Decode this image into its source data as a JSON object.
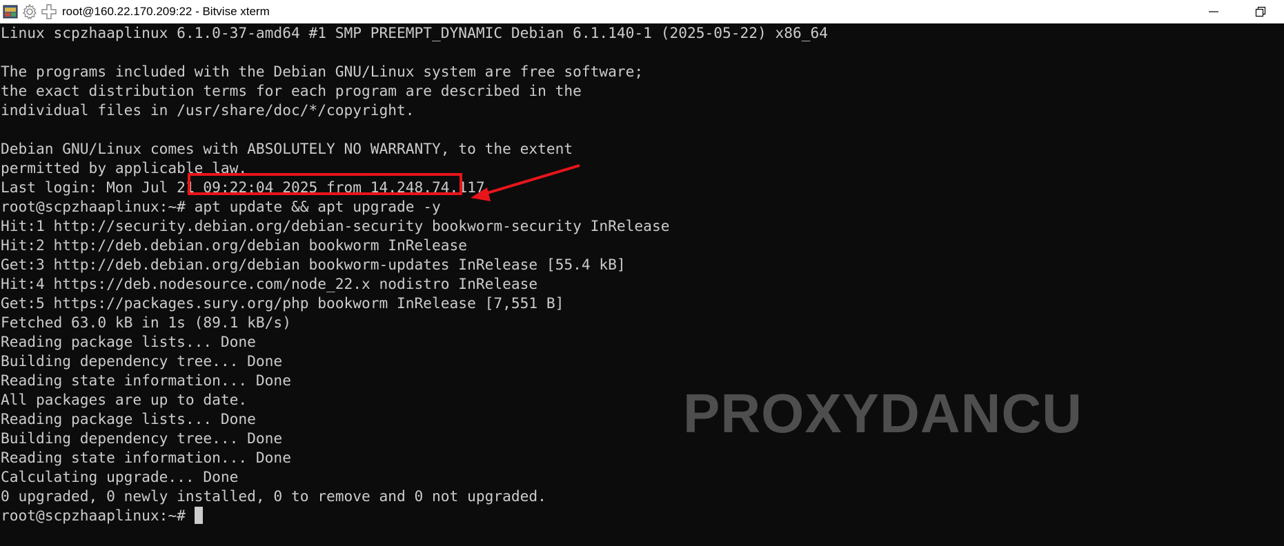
{
  "window": {
    "title": "root@160.22.170.209:22 - Bitvise xterm",
    "icons": [
      "app-icon",
      "gear-icon",
      "new-window-icon"
    ],
    "controls": [
      "minimize-icon",
      "restore-icon"
    ]
  },
  "terminal": {
    "lines": [
      "Linux scpzhaaplinux 6.1.0-37-amd64 #1 SMP PREEMPT_DYNAMIC Debian 6.1.140-1 (2025-05-22) x86_64",
      "",
      "The programs included with the Debian GNU/Linux system are free software;",
      "the exact distribution terms for each program are described in the",
      "individual files in /usr/share/doc/*/copyright.",
      "",
      "Debian GNU/Linux comes with ABSOLUTELY NO WARRANTY, to the extent",
      "permitted by applicable law.",
      "Last login: Mon Jul 21 09:22:04 2025 from 14.248.74.117",
      "root@scpzhaaplinux:~# apt update && apt upgrade -y",
      "Hit:1 http://security.debian.org/debian-security bookworm-security InRelease",
      "Hit:2 http://deb.debian.org/debian bookworm InRelease",
      "Get:3 http://deb.debian.org/debian bookworm-updates InRelease [55.4 kB]",
      "Hit:4 https://deb.nodesource.com/node_22.x nodistro InRelease",
      "Get:5 https://packages.sury.org/php bookworm InRelease [7,551 B]",
      "Fetched 63.0 kB in 1s (89.1 kB/s)",
      "Reading package lists... Done",
      "Building dependency tree... Done",
      "Reading state information... Done",
      "All packages are up to date.",
      "Reading package lists... Done",
      "Building dependency tree... Done",
      "Reading state information... Done",
      "Calculating upgrade... Done",
      "0 upgraded, 0 newly installed, 0 to remove and 0 not upgraded.",
      "root@scpzhaaplinux:~# "
    ],
    "highlighted_command": "apt update && apt upgrade -y",
    "annotation_color": "#e8151b",
    "text_color": "#cccccc",
    "background_color": "#0c0c0c"
  },
  "watermark": {
    "text": "PROXYDANCU"
  }
}
